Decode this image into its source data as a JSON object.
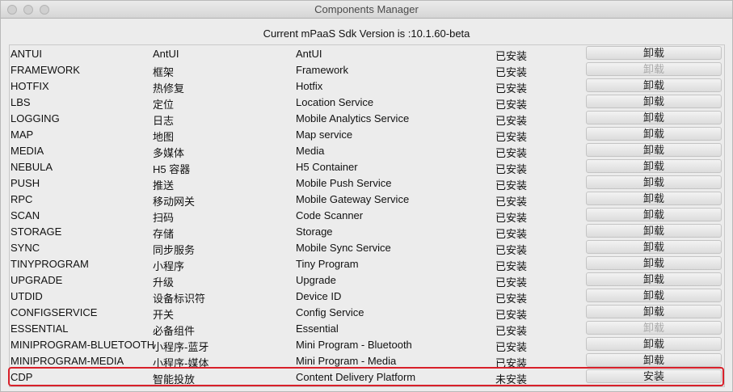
{
  "window": {
    "title": "Components Manager"
  },
  "version_text": "Current mPaaS Sdk Version is :10.1.60-beta",
  "components": [
    {
      "name": "ANTUI",
      "cn": "AntUI",
      "desc": "AntUI",
      "status": "已安装",
      "action": "卸载",
      "enabled": true
    },
    {
      "name": "FRAMEWORK",
      "cn": "框架",
      "desc": "Framework",
      "status": "已安装",
      "action": "卸载",
      "enabled": false
    },
    {
      "name": "HOTFIX",
      "cn": "热修复",
      "desc": "Hotfix",
      "status": "已安装",
      "action": "卸载",
      "enabled": true
    },
    {
      "name": "LBS",
      "cn": "定位",
      "desc": "Location Service",
      "status": "已安装",
      "action": "卸载",
      "enabled": true
    },
    {
      "name": "LOGGING",
      "cn": "日志",
      "desc": "Mobile Analytics Service",
      "status": "已安装",
      "action": "卸载",
      "enabled": true
    },
    {
      "name": "MAP",
      "cn": "地图",
      "desc": "Map service",
      "status": "已安装",
      "action": "卸载",
      "enabled": true
    },
    {
      "name": "MEDIA",
      "cn": "多媒体",
      "desc": "Media",
      "status": "已安装",
      "action": "卸载",
      "enabled": true
    },
    {
      "name": "NEBULA",
      "cn": "H5 容器",
      "desc": "H5 Container",
      "status": "已安装",
      "action": "卸载",
      "enabled": true
    },
    {
      "name": "PUSH",
      "cn": "推送",
      "desc": "Mobile Push Service",
      "status": "已安装",
      "action": "卸载",
      "enabled": true
    },
    {
      "name": "RPC",
      "cn": "移动网关",
      "desc": "Mobile Gateway Service",
      "status": "已安装",
      "action": "卸载",
      "enabled": true
    },
    {
      "name": "SCAN",
      "cn": "扫码",
      "desc": "Code Scanner",
      "status": "已安装",
      "action": "卸载",
      "enabled": true
    },
    {
      "name": "STORAGE",
      "cn": "存储",
      "desc": "Storage",
      "status": "已安装",
      "action": "卸载",
      "enabled": true
    },
    {
      "name": "SYNC",
      "cn": "同步服务",
      "desc": "Mobile Sync Service",
      "status": "已安装",
      "action": "卸载",
      "enabled": true
    },
    {
      "name": "TINYPROGRAM",
      "cn": "小程序",
      "desc": "Tiny Program",
      "status": "已安装",
      "action": "卸载",
      "enabled": true
    },
    {
      "name": "UPGRADE",
      "cn": "升级",
      "desc": "Upgrade",
      "status": "已安装",
      "action": "卸载",
      "enabled": true
    },
    {
      "name": "UTDID",
      "cn": "设备标识符",
      "desc": "Device ID",
      "status": "已安装",
      "action": "卸载",
      "enabled": true
    },
    {
      "name": "CONFIGSERVICE",
      "cn": "开关",
      "desc": "Config Service",
      "status": "已安装",
      "action": "卸载",
      "enabled": true
    },
    {
      "name": "ESSENTIAL",
      "cn": "必备组件",
      "desc": "Essential",
      "status": "已安装",
      "action": "卸载",
      "enabled": false
    },
    {
      "name": "MINIPROGRAM-BLUETOOTH",
      "cn": "小程序-蓝牙",
      "desc": "Mini Program - Bluetooth",
      "status": "已安装",
      "action": "卸载",
      "enabled": true
    },
    {
      "name": "MINIPROGRAM-MEDIA",
      "cn": "小程序-媒体",
      "desc": "Mini Program - Media",
      "status": "已安装",
      "action": "卸载",
      "enabled": true
    },
    {
      "name": "CDP",
      "cn": "智能投放",
      "desc": "Content Delivery Platform",
      "status": "未安装",
      "action": "安装",
      "enabled": true,
      "highlighted": true
    }
  ],
  "colors": {
    "highlight": "#d8202a",
    "disabled_text": "#a9a9a9"
  }
}
